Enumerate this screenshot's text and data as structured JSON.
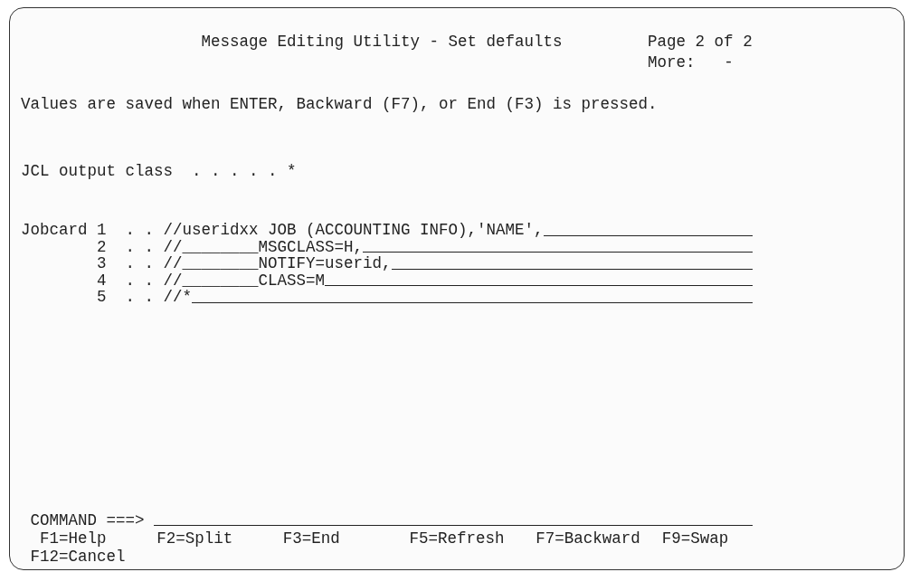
{
  "header": {
    "title": "Message Editing Utility - Set defaults",
    "page": "Page 2 of 2",
    "more_label": "More:",
    "more_value": "-"
  },
  "instruction": "Values are saved when ENTER, Backward (F7), or End (F3) is pressed.",
  "output_class": {
    "label": "JCL output class",
    "leader": ". . . . .",
    "value": "*"
  },
  "jobcard": {
    "label": "Jobcard",
    "lines": [
      {
        "number": "1",
        "leader": ". .",
        "value": "//useridxx JOB (ACCOUNTING INFO),'NAME',"
      },
      {
        "number": "2",
        "leader": ". .",
        "value": "//________MSGCLASS=H,"
      },
      {
        "number": "3",
        "leader": ". .",
        "value": "//________NOTIFY=userid,"
      },
      {
        "number": "4",
        "leader": ". .",
        "value": "//________CLASS=M"
      },
      {
        "number": "5",
        "leader": ". .",
        "value": "//*"
      }
    ]
  },
  "command": {
    "label": "COMMAND ===>"
  },
  "function_keys": [
    "F1=Help",
    "F2=Split",
    "F3=End",
    "F5=Refresh",
    "F7=Backward",
    "F9=Swap",
    "F12=Cancel"
  ]
}
